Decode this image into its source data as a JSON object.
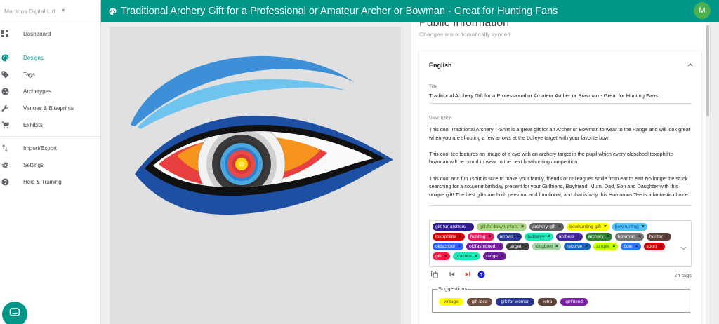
{
  "sidebar": {
    "company": "Martinos Digital Ltd",
    "items": [
      {
        "label": "Dashboard",
        "icon": "dashboard-icon"
      },
      {
        "label": "Designs",
        "icon": "palette-icon",
        "active": true
      },
      {
        "label": "Tags",
        "icon": "tag-icon"
      },
      {
        "label": "Archetypes",
        "icon": "archetype-icon"
      },
      {
        "label": "Venues & Blueprints",
        "icon": "wrench-icon"
      },
      {
        "label": "Exhibits",
        "icon": "cart-icon"
      },
      {
        "label": "Import/Export",
        "icon": "import-export-icon"
      },
      {
        "label": "Settings",
        "icon": "gear-icon"
      },
      {
        "label": "Help & Training",
        "icon": "help-icon"
      }
    ]
  },
  "header": {
    "title": "Traditional Archery Gift for a Professional or Amateur Archer or Bowman - Great for Hunting Fans",
    "avatar": "M",
    "color": "#009688"
  },
  "panel": {
    "heading": "Public Information",
    "subheading": "Changes are automatically synced",
    "language": "English",
    "title_label": "Title",
    "title_value": "Traditional Archery Gift for a Professional or Amateur Archer or Bowman - Great for Hunting Fans",
    "description_label": "Description",
    "description": [
      "This cool Traditional Archery T-Shirt is a great gift for an Archer or Bowman to wear to the Range and will look great when you are shooting a few arrows at the bulleye target with your favorite bow!",
      "This cool tee features an image of a eye with an archery target in the pupil which every oldschool toxophilite bowman will be proud to wear to the next bowhunting competition.",
      "This cool and fun Tshirt is sure to make your family, friends or colleagues smile from ear to ear! No longer be stuck searching for a souvenir birthday present for your Girlfriend, Boyfriend, Mum, Dad, Son and Daughter with this unique gift! The best gifts are both personal and functional, and  that is why this Humorous Tee is a fantastic choice."
    ],
    "tags": [
      {
        "text": "gift-for-archers",
        "bg": "#311b92",
        "fg": "#ffffff"
      },
      {
        "text": "gift-for-bowhunters",
        "bg": "#aed581",
        "fg": "#33691e"
      },
      {
        "text": "archery-gift",
        "bg": "#616161",
        "fg": "#ffffff"
      },
      {
        "text": "bowhunting-gift",
        "bg": "#ffff00",
        "fg": "#5d4037"
      },
      {
        "text": "bowhunting",
        "bg": "#4fc3f7",
        "fg": "#0d47a1"
      },
      {
        "text": "toxophilite",
        "bg": "#d50000",
        "fg": "#ffffff"
      },
      {
        "text": "hunting",
        "bg": "#e91e63",
        "fg": "#ffffff"
      },
      {
        "text": "arrows",
        "bg": "#283593",
        "fg": "#ffffff"
      },
      {
        "text": "bullseye",
        "bg": "#1de9b6",
        "fg": "#004d40"
      },
      {
        "text": "archers",
        "bg": "#4527a0",
        "fg": "#ffffff"
      },
      {
        "text": "archery",
        "bg": "#2e7d32",
        "fg": "#ffffff"
      },
      {
        "text": "bowman",
        "bg": "#757575",
        "fg": "#ffffff"
      },
      {
        "text": "hunter",
        "bg": "#5d4037",
        "fg": "#ffffff"
      },
      {
        "text": "oldschool",
        "bg": "#2962ff",
        "fg": "#ffffff"
      },
      {
        "text": "oldfashioned",
        "bg": "#7b1fa2",
        "fg": "#ffffff"
      },
      {
        "text": "target",
        "bg": "#424242",
        "fg": "#ffffff"
      },
      {
        "text": "longbow",
        "bg": "#a5d6a7",
        "fg": "#1b5e20"
      },
      {
        "text": "recurve",
        "bg": "#1565c0",
        "fg": "#ffffff"
      },
      {
        "text": "simple",
        "bg": "#c6ff00",
        "fg": "#33691e"
      },
      {
        "text": "bow",
        "bg": "#2979ff",
        "fg": "#ffffff"
      },
      {
        "text": "sport",
        "bg": "#d50000",
        "fg": "#ffffff"
      },
      {
        "text": "gift",
        "bg": "#ff1744",
        "fg": "#ffffff"
      },
      {
        "text": "practice",
        "bg": "#1de9b6",
        "fg": "#004d40"
      },
      {
        "text": "range",
        "bg": "#6a1b9a",
        "fg": "#ffffff"
      }
    ],
    "tag_count": "24 tags",
    "suggestions_label": "Suggestions",
    "suggestions": [
      {
        "text": "vintage",
        "bg": "#ffff00",
        "fg": "#5d4037"
      },
      {
        "text": "gift-idea",
        "bg": "#6d4c41",
        "fg": "#ffffff"
      },
      {
        "text": "gift-for-women",
        "bg": "#283593",
        "fg": "#ffffff"
      },
      {
        "text": "retro",
        "bg": "#5d4037",
        "fg": "#ffffff"
      },
      {
        "text": "girlfriend",
        "bg": "#7b1fa2",
        "fg": "#ffffff"
      }
    ]
  }
}
